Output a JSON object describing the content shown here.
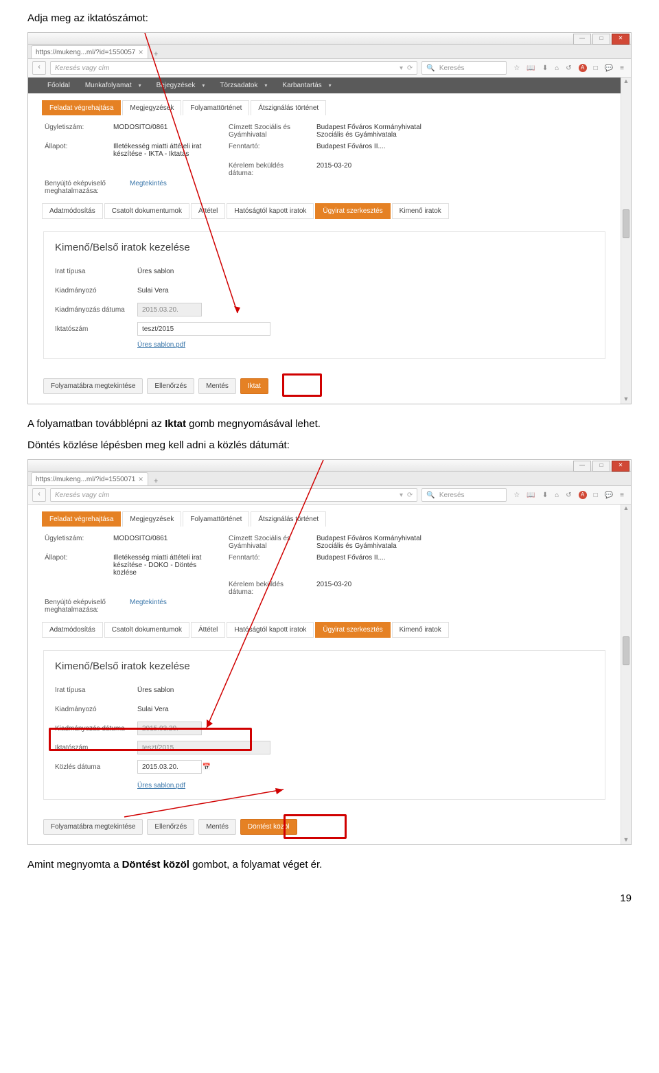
{
  "pageNumber": "19",
  "doc": {
    "line1": "Adja meg az iktatószámot:",
    "line2_pre": "A folyamatban továbblépni az ",
    "line2_bold": "Iktat",
    "line2_post": " gomb megnyomásával lehet.",
    "line3": "Döntés közlése lépésben meg kell adni a közlés dátumát:",
    "line4_pre": "Amint megnyomta a ",
    "line4_bold": "Döntést közöl",
    "line4_post": " gombot, a folyamat véget ér."
  },
  "browser": {
    "tab1": "https://mukeng...ml/?id=1550057",
    "tab2": "https://mukeng...ml/?id=1550071",
    "urlPlaceholder": "Keresés vagy cím",
    "reloadGlyph": "⟳",
    "searchIcon": "🔍",
    "searchPlaceholder": "Keresés",
    "icons": {
      "star": "☆",
      "book": "📖",
      "down": "⬇",
      "home": "⌂",
      "sync": "↺",
      "adblock": "A",
      "box": "□",
      "speech": "💬",
      "menu": "≡"
    },
    "win": {
      "min": "—",
      "max": "□",
      "close": "✕"
    },
    "tabclose": "✕",
    "plus": "+"
  },
  "appnav": {
    "items": [
      "Főoldal",
      "Munkafolyamat",
      "Bejegyzések",
      "Törzsadatok",
      "Karbantartás"
    ],
    "caret": "▾"
  },
  "maintabs": [
    "Feladat végrehajtása",
    "Megjegyzések",
    "Folyamattörténet",
    "Átszignálás történet"
  ],
  "details_labels": {
    "ugyleti": "Ügyletiszám:",
    "allapot": "Állapot:",
    "cimzett": "Címzett Szociális és Gyámhivatal",
    "fenntarto": "Fenntartó:",
    "kerelem": "Kérelem beküldés dátuma:",
    "rep": "Benyújtó eképviselő meghatalmazása:",
    "megtekintes": "Megtekintés"
  },
  "details1": {
    "ugyleti": "MODOSITO/0861",
    "allapot": "Illetékesség miatti áttételi irat készítése - IKTA - Iktatás",
    "cimzett_val": "Budapest Főváros Kormányhivatal Szociális és Gyámhivatala",
    "fenntarto": "Budapest Főváros II....",
    "kerelem": "2015-03-20"
  },
  "details2": {
    "ugyleti": "MODOSITO/0861",
    "allapot": "Illetékesség miatti áttételi irat készítése - DOKO - Döntés közlése",
    "cimzett_val": "Budapest Főváros Kormányhivatal Szociális és Gyámhivatala",
    "fenntarto": "Budapest Főváros II....",
    "kerelem": "2015-03-20"
  },
  "subtabs": [
    "Adatmódosítás",
    "Csatolt dokumentumok",
    "Áttétel",
    "Hatóságtól kapott iratok",
    "Ügyirat szerkesztés",
    "Kimenő iratok"
  ],
  "panel": {
    "title": "Kimenő/Belső iratok kezelése",
    "labels": {
      "irat": "Irat típusa",
      "kiadm": "Kiadmányozó",
      "kdate": "Kiadmányozás dátuma",
      "iktato": "Iktatószám",
      "kozles": "Közlés dátuma",
      "file": "Üres sablon.pdf"
    },
    "values": {
      "irat": "Üres sablon",
      "kiadm": "Sulai Vera",
      "kdate": "2015.03.20.",
      "iktato": "teszt/2015",
      "kozles": "2015.03.20.",
      "calglyph": "📅"
    }
  },
  "actions1": {
    "b1": "Folyamatábra megtekintése",
    "b2": "Ellenőrzés",
    "b3": "Mentés",
    "primary": "Iktat"
  },
  "actions2": {
    "b1": "Folyamatábra megtekintése",
    "b2": "Ellenőrzés",
    "b3": "Mentés",
    "primary": "Döntést közöl"
  }
}
